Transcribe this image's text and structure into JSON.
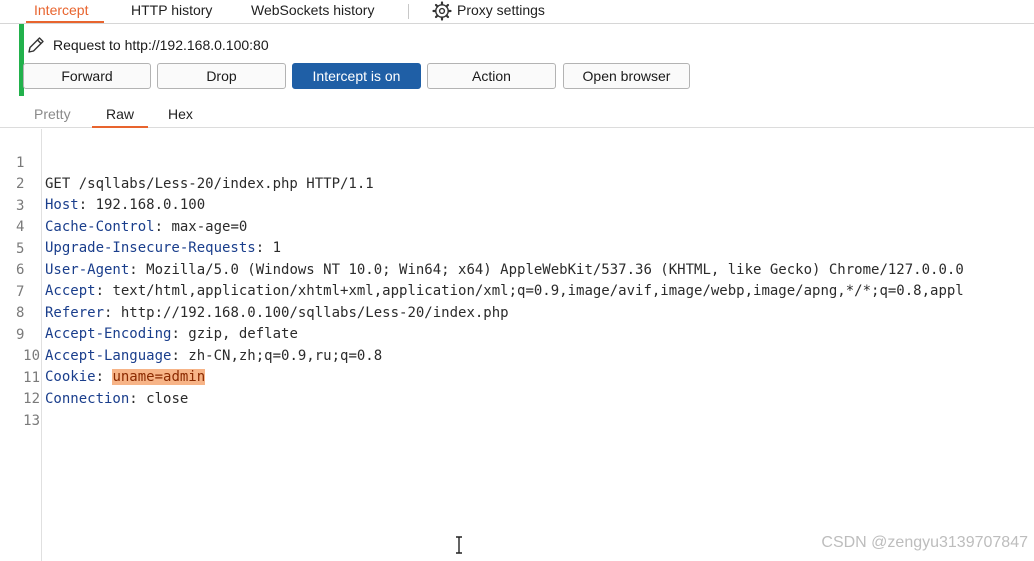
{
  "top_tabs": [
    "Intercept",
    "HTTP history",
    "WebSockets history",
    "Proxy settings"
  ],
  "request_label": "Request to http://192.168.0.100:80",
  "buttons": {
    "forward": "Forward",
    "drop": "Drop",
    "intercept": "Intercept is on",
    "action": "Action",
    "open_browser": "Open browser"
  },
  "view_tabs": [
    "Pretty",
    "Raw",
    "Hex"
  ],
  "request_lines": [
    {
      "num": "1",
      "key": "",
      "sep": "",
      "value": "GET /sqllabs/Less-20/index.php HTTP/1.1"
    },
    {
      "num": "2",
      "key": "Host",
      "sep": ": ",
      "value": "192.168.0.100"
    },
    {
      "num": "3",
      "key": "Cache-Control",
      "sep": ": ",
      "value": "max-age=0"
    },
    {
      "num": "4",
      "key": "Upgrade-Insecure-Requests",
      "sep": ": ",
      "value": "1"
    },
    {
      "num": "5",
      "key": "User-Agent",
      "sep": ": ",
      "value": "Mozilla/5.0 (Windows NT 10.0; Win64; x64) AppleWebKit/537.36 (KHTML, like Gecko) Chrome/127.0.0.0"
    },
    {
      "num": "6",
      "key": "Accept",
      "sep": ": ",
      "value": "text/html,application/xhtml+xml,application/xml;q=0.9,image/avif,image/webp,image/apng,*/*;q=0.8,appl"
    },
    {
      "num": "7",
      "key": "Referer",
      "sep": ": ",
      "value": "http://192.168.0.100/sqllabs/Less-20/index.php"
    },
    {
      "num": "8",
      "key": "Accept-Encoding",
      "sep": ": ",
      "value": "gzip, deflate"
    },
    {
      "num": "9",
      "key": "Accept-Language",
      "sep": ": ",
      "value": "zh-CN,zh;q=0.9,ru;q=0.8"
    },
    {
      "num": "10",
      "key": "Cookie",
      "sep": ": ",
      "value": "uname=admin"
    },
    {
      "num": "11",
      "key": "Connection",
      "sep": ": ",
      "value": "close"
    },
    {
      "num": "12",
      "key": "",
      "sep": "",
      "value": ""
    },
    {
      "num": "13",
      "key": "",
      "sep": "",
      "value": ""
    }
  ],
  "watermark": "CSDN @zengyu3139707847",
  "colors": {
    "accent": "#e8642e",
    "primary_button": "#1f5fa6",
    "marker": "#22b14c",
    "highlight": "#f7b487"
  }
}
